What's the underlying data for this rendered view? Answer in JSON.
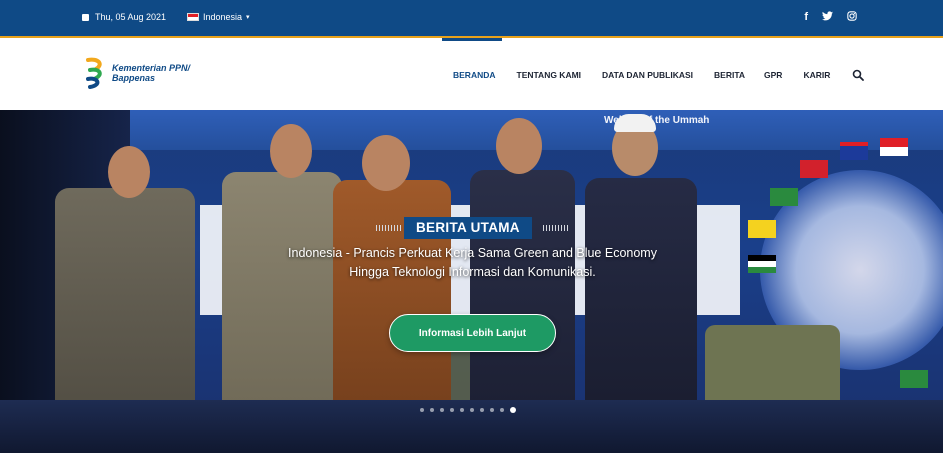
{
  "topbar": {
    "date": "Thu, 05 Aug 2021",
    "language": "Indonesia",
    "social": [
      {
        "icon": "facebook-icon",
        "glyph": "f"
      },
      {
        "icon": "twitter-icon",
        "glyph": "🐦"
      },
      {
        "icon": "instagram-icon",
        "glyph": "◎"
      }
    ]
  },
  "logo": {
    "line1": "Kementerian PPN/",
    "line2": "Bappenas"
  },
  "menu": {
    "items": [
      "BERANDA",
      "TENTANG KAMI",
      "DATA DAN PUBLIKASI",
      "BERITA",
      "GPR",
      "KARIR"
    ],
    "active_index": 0
  },
  "hero": {
    "banner_text": "Welfare of the Ummah",
    "badge": "BERITA UTAMA",
    "headline": "Indonesia - Prancis Perkuat Kerja Sama Green and Blue Economy Hingga Teknologi Informasi dan Komunikasi.",
    "cta": "Informasi Lebih Lanjut",
    "slides_total": 10,
    "active_slide": 10
  },
  "colors": {
    "primary": "#0f4a86",
    "accent": "#e8a21b",
    "cta": "#1e9a64"
  }
}
